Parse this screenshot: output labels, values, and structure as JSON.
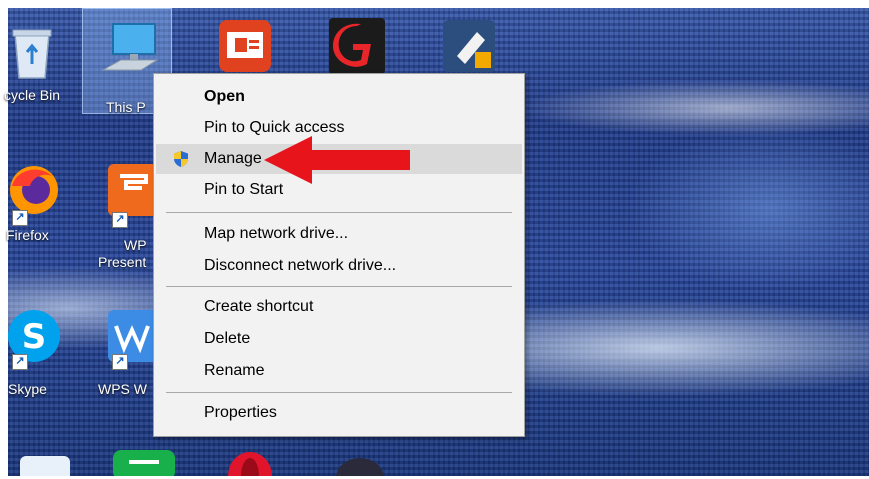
{
  "desktop": {
    "icons": [
      {
        "label": "cycle Bin"
      },
      {
        "label": "This P"
      },
      {
        "label": "Firefox"
      },
      {
        "label": "WP"
      },
      {
        "label": "Present"
      },
      {
        "label": "Skype"
      },
      {
        "label": "WPS W"
      }
    ]
  },
  "context_menu": {
    "items": [
      {
        "label": "Open",
        "bold": true
      },
      {
        "label": "Pin to Quick access"
      },
      {
        "label": "Manage",
        "icon": "shield-icon",
        "highlighted": true
      },
      {
        "label": "Pin to Start"
      },
      {
        "label": "Map network drive..."
      },
      {
        "label": "Disconnect network drive..."
      },
      {
        "label": "Create shortcut"
      },
      {
        "label": "Delete"
      },
      {
        "label": "Rename"
      },
      {
        "label": "Properties"
      }
    ]
  },
  "annotation": {
    "arrow_color": "#e8141c",
    "points_to": "Manage"
  },
  "colors": {
    "menu_bg": "#f2f2f2",
    "highlight": "#dadada",
    "separator": "#a8a8a8"
  }
}
